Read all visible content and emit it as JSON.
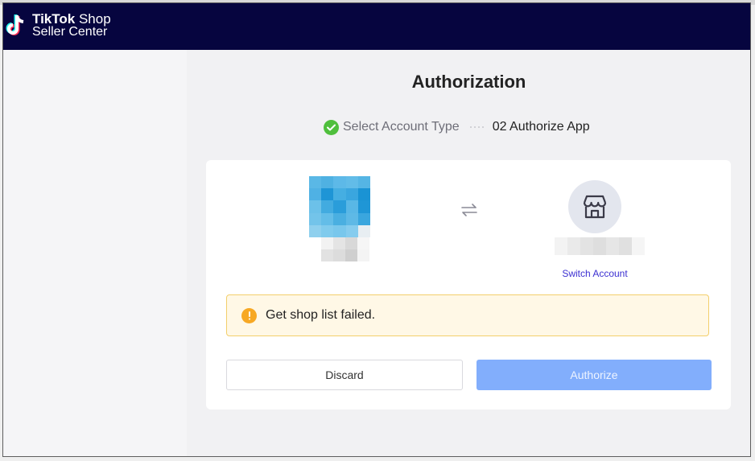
{
  "header": {
    "logo_line1_bold": "TikTok",
    "logo_line1_rest": " Shop",
    "logo_line2": "Seller Center"
  },
  "page": {
    "title": "Authorization"
  },
  "steps": {
    "step1_label": "Select Account Type",
    "step2_label": "02 Authorize App"
  },
  "card": {
    "switch_account_label": "Switch Account",
    "alert_message": "Get shop list failed.",
    "discard_label": "Discard",
    "authorize_label": "Authorize"
  },
  "icons": {
    "logo": "tiktok-logo-icon",
    "step_done": "check-circle-icon",
    "swap": "swap-arrows-icon",
    "shop": "storefront-icon",
    "alert": "warning-circle-icon"
  },
  "colors": {
    "header_bg": "#06053f",
    "success": "#4fbf3c",
    "warning": "#f7a823",
    "link": "#3b2fd1",
    "primary_disabled": "#82aefc"
  }
}
